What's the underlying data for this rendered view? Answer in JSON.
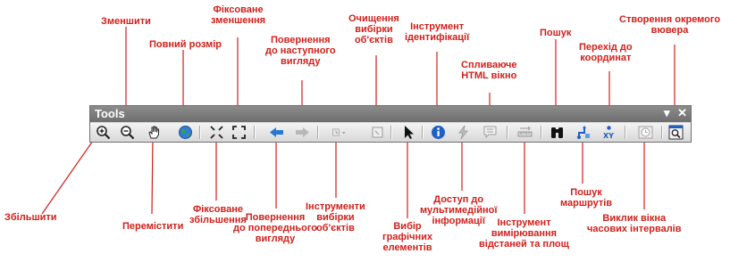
{
  "toolbar": {
    "title": "Tools",
    "controls": {
      "menu": "▾",
      "close": "✕"
    }
  },
  "labels": {
    "zoom_in": "Збільшити",
    "zoom_out": "Зменшити",
    "pan": "Перемістити",
    "full_extent": "Повний розмір",
    "fixed_zoom_in": "Фіксоване\nзбільшення",
    "fixed_zoom_out": "Фіксоване\nзменшення",
    "go_back": "Повернення\nдо попереднього\nвигляду",
    "go_forward": "Повернення\nдо наступного\nвигляду",
    "select_features": "Інструменти\nвибірки\nоб'єктів",
    "clear_selection": "Очищення\nвибірки\nоб'єктів",
    "select_elements": "Вибір\nграфічних\nелементів",
    "identify": "Інструмент\nідентифікації",
    "hyperlink": "Доступ до\nмультимедійної\nінформації",
    "html_popup": "Спливаюче\nHTML вікно",
    "measure": "Інструмент\nвимірювання\nвідстаней та площ",
    "find": "Пошук",
    "find_route": "Пошук\nмаршрутів",
    "go_to_xy": "Перехід до\nкоординат",
    "time_slider": "Виклик вікна\nчасових інтервалів",
    "viewer_window": "Створення окремого\nвювера"
  },
  "colors": {
    "label_red": "#d0201a",
    "titlebar": "#7a7a7a"
  }
}
